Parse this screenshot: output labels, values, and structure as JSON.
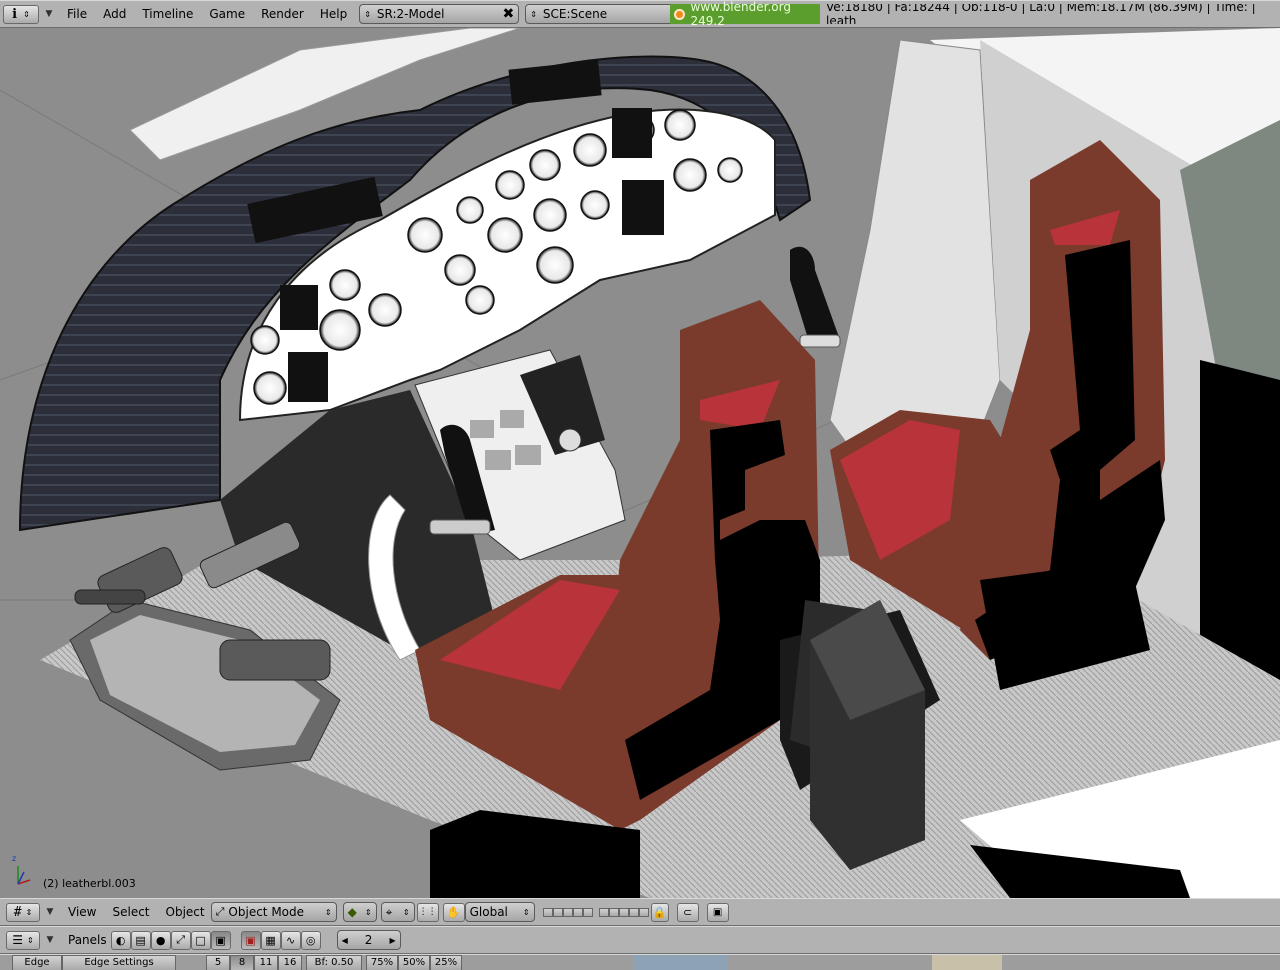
{
  "topbar": {
    "menus": [
      "File",
      "Add",
      "Timeline",
      "Game",
      "Render",
      "Help"
    ],
    "screen_field": "SR:2-Model",
    "scene_field": "SCE:Scene",
    "website": "www.blender.org 249.2",
    "stats": "Ve:18180 | Fa:18244 | Ob:118-0 | La:0 | Mem:18.17M (86.39M) | Time: | leath"
  },
  "viewport": {
    "object_label": "(2) leatherbl.003",
    "axis_x": "x",
    "axis_y": "y",
    "axis_z": "z"
  },
  "view_header": {
    "menus": [
      "View",
      "Select",
      "Object"
    ],
    "mode": "Object Mode",
    "orientation": "Global"
  },
  "buttons_header": {
    "panels_label": "Panels",
    "frame": "2"
  },
  "button_strip": {
    "tab_edge": "Edge",
    "tab_edge_settings": "Edge Settings",
    "numbers": [
      "5",
      "8",
      "11",
      "16"
    ],
    "bf": "Bf: 0.50",
    "percents": [
      "75%",
      "50%",
      "25%"
    ]
  },
  "colors": {
    "panel": "#b2b2b2",
    "viewport_bg": "#8d8d8d",
    "seat_leather": "#7a3a2c",
    "seat_red": "#b8343a",
    "dash_dark": "#2c2f3a",
    "status_green": "#5c9e2e"
  },
  "icons": [
    "info-icon",
    "grid-icon",
    "windows-icon",
    "render-icon",
    "close-icon",
    "world-icon",
    "lock-icon",
    "hand-icon",
    "target-icon"
  ]
}
